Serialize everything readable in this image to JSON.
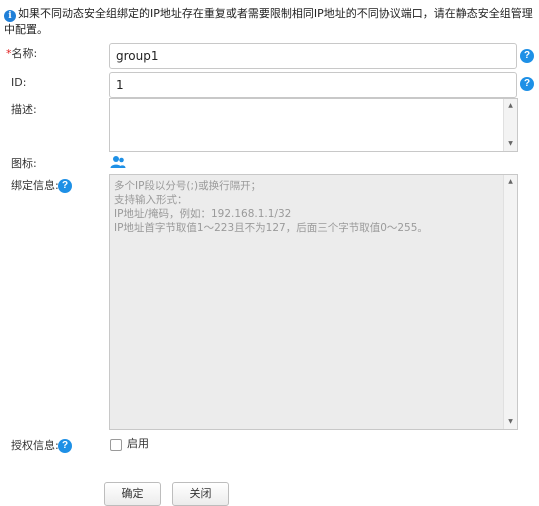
{
  "notice": {
    "text": "如果不同动态安全组绑定的IP地址存在重复或者需要限制相同IP地址的不同协议端口，请在静态安全组管理中配置。"
  },
  "form": {
    "name": {
      "label": "名称:",
      "value": "group1"
    },
    "id": {
      "label": "ID:",
      "value": "1"
    },
    "description": {
      "label": "描述:",
      "value": ""
    },
    "icon": {
      "label": "图标:",
      "icon_name": "user-group-icon"
    },
    "binding": {
      "label": "绑定信息:",
      "placeholder": "多个IP段以分号(;)或换行隔开；\n支持输入形式：\nIP地址/掩码，例如：192.168.1.1/32\nIP地址首字节取值1～223且不为127，后面三个字节取值0～255。"
    },
    "authorization": {
      "label": "授权信息:",
      "checkbox_label": "启用",
      "checked": false
    }
  },
  "buttons": {
    "confirm": "确定",
    "close": "关闭"
  },
  "colors": {
    "accent": "#1e90e6",
    "required": "#e02020"
  }
}
